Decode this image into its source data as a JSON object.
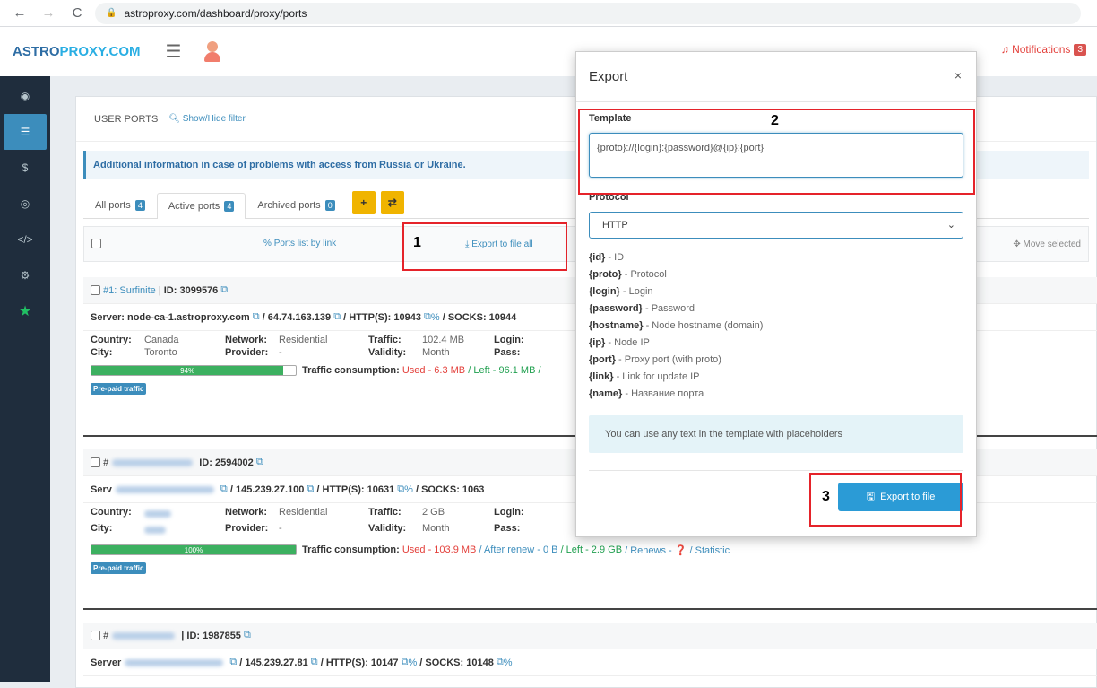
{
  "browser": {
    "url": "astroproxy.com/dashboard/proxy/ports"
  },
  "header": {
    "brand_a": "ASTRO",
    "brand_b": "PROXY.COM",
    "notifications_label": "Notifications",
    "notifications_count": "3"
  },
  "panel": {
    "title": "USER PORTS",
    "filter": "Show/Hide filter",
    "info": "Additional information in case of problems with access from Russia or Ukraine.",
    "tabs": [
      {
        "label": "All ports",
        "count": "4"
      },
      {
        "label": "Active ports",
        "count": "4"
      },
      {
        "label": "Archived ports",
        "count": "0"
      }
    ],
    "ports_list_link": "Ports list by link",
    "export_all": "Export to file all",
    "move_selected": "Move selected"
  },
  "ports": [
    {
      "title": "#1: Surfinite",
      "id": "ID: 3099576",
      "server": "Server: node-ca-1.astroproxy.com",
      "ip": "/ 64.74.163.139",
      "http": "/ HTTP(S): 10943",
      "socks": "/ SOCKS: 10944",
      "country": "Canada",
      "city": "Toronto",
      "network": "Residential",
      "provider": "-",
      "traffic": "102.4 MB",
      "validity": "Month",
      "progress": "94%",
      "consumption_label": "Traffic consumption:",
      "used": "Used - 6.3 MB",
      "left": "/ Left - 96.1 MB /",
      "prepaid": "Pre-paid traffic"
    },
    {
      "title": "#",
      "id": "ID: 2594002",
      "server": "Serv",
      "ip": "/ 145.239.27.100",
      "http": "/ HTTP(S): 10631",
      "socks": "/ SOCKS: 1063",
      "country": "",
      "city": "",
      "network": "Residential",
      "provider": "-",
      "traffic": "2 GB",
      "validity": "Month",
      "progress": "100%",
      "consumption_label": "Traffic consumption:",
      "used": "Used - 103.9 MB",
      "after": "/ After renew - 0 B",
      "left": "/ Left - 2.9 GB",
      "renews": "/ Renews - ❓ / Statistic",
      "prepaid": "Pre-paid traffic"
    },
    {
      "title": "#",
      "id": "| ID: 1987855",
      "server": "Server",
      "ip": "/ 145.239.27.81",
      "http": "/ HTTP(S): 10147",
      "socks": "/ SOCKS: 10148"
    }
  ],
  "labels": {
    "country": "Country:",
    "city": "City:",
    "network": "Network:",
    "provider": "Provider:",
    "traffic": "Traffic:",
    "validity": "Validity:",
    "login": "Login:",
    "pass": "Pass:"
  },
  "modal": {
    "title": "Export",
    "close": "×",
    "template_label": "Template",
    "template_value": "{proto}://{login}:{password}@{ip}:{port}",
    "protocol_label": "Protocol",
    "protocol_value": "HTTP",
    "placeholders": [
      {
        "key": "{id}",
        "desc": " - ID"
      },
      {
        "key": "{proto}",
        "desc": " - Protocol"
      },
      {
        "key": "{login}",
        "desc": " - Login"
      },
      {
        "key": "{password}",
        "desc": " - Password"
      },
      {
        "key": "{hostname}",
        "desc": " - Node hostname (domain)"
      },
      {
        "key": "{ip}",
        "desc": " - Node IP"
      },
      {
        "key": "{port}",
        "desc": " - Proxy port (with proto)"
      },
      {
        "key": "{link}",
        "desc": " - Link for update IP"
      },
      {
        "key": "{name}",
        "desc": " - Название порта"
      }
    ],
    "info": "You can use any text in the template with placeholders",
    "export_button": "Export to file"
  },
  "annotations": {
    "n1": "1",
    "n2": "2",
    "n3": "3"
  }
}
